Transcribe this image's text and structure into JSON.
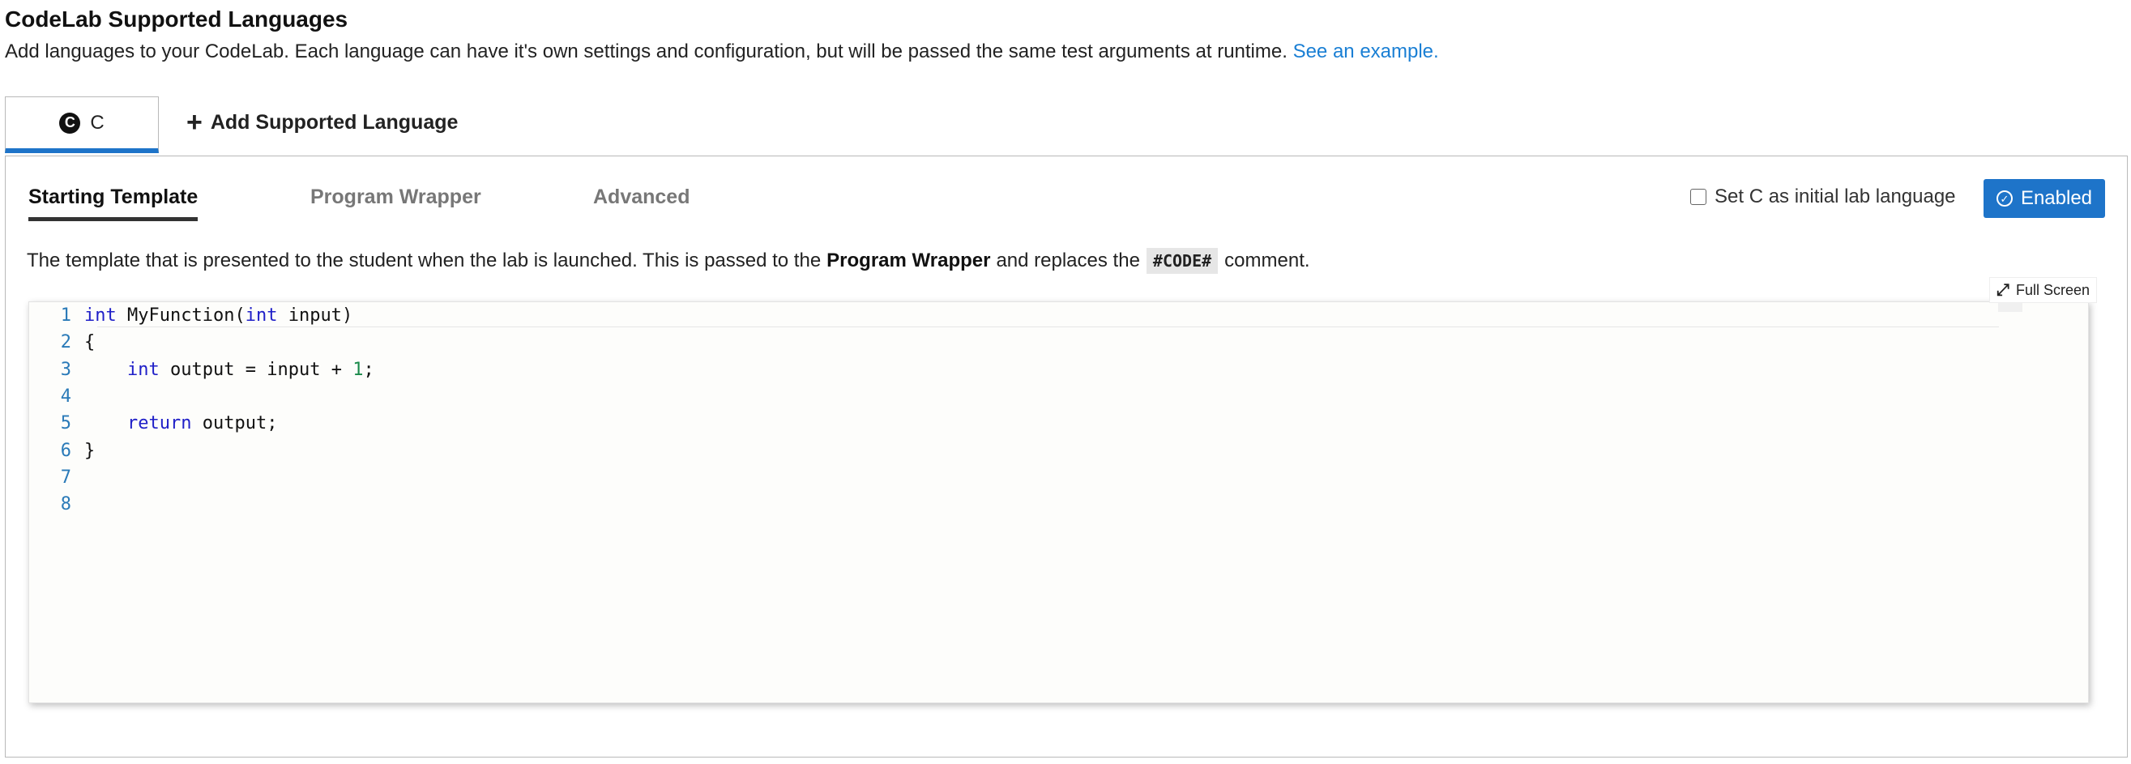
{
  "header": {
    "title": "CodeLab Supported Languages",
    "description": "Add languages to your CodeLab. Each language can have it's own settings and configuration, but will be passed the same test arguments at runtime.",
    "example_link": "See an example."
  },
  "language_tabs": {
    "active_tab": {
      "label": "C",
      "icon": "c-language-icon"
    },
    "add_label": "Add Supported Language"
  },
  "sub_tabs": [
    {
      "label": "Starting Template",
      "active": true
    },
    {
      "label": "Program Wrapper",
      "active": false
    },
    {
      "label": "Advanced",
      "active": false
    }
  ],
  "initial_language": {
    "label": "Set C as initial lab language",
    "checked": false
  },
  "enabled_button": {
    "label": "Enabled",
    "color": "#1e74c9"
  },
  "template_description": {
    "prefix": "The template that is presented to the student when the lab is launched. This is passed to the",
    "bold": "Program Wrapper",
    "middle": "and replaces the",
    "code": "#CODE#",
    "suffix": "comment."
  },
  "editor": {
    "fullscreen_label": "Full Screen",
    "lines": [
      {
        "number": "1",
        "code": "int MyFunction(int input)"
      },
      {
        "number": "2",
        "code": "{"
      },
      {
        "number": "3",
        "code": "    int output = input + 1;"
      },
      {
        "number": "4",
        "code": ""
      },
      {
        "number": "5",
        "code": "    return output;"
      },
      {
        "number": "6",
        "code": "}"
      },
      {
        "number": "7",
        "code": ""
      },
      {
        "number": "8",
        "code": ""
      }
    ]
  },
  "colors": {
    "accent": "#1e74c9",
    "link": "#1a7fd4",
    "keyword": "#2020c8",
    "number": "#1a8a4a",
    "line_number": "#2a7ab8"
  }
}
